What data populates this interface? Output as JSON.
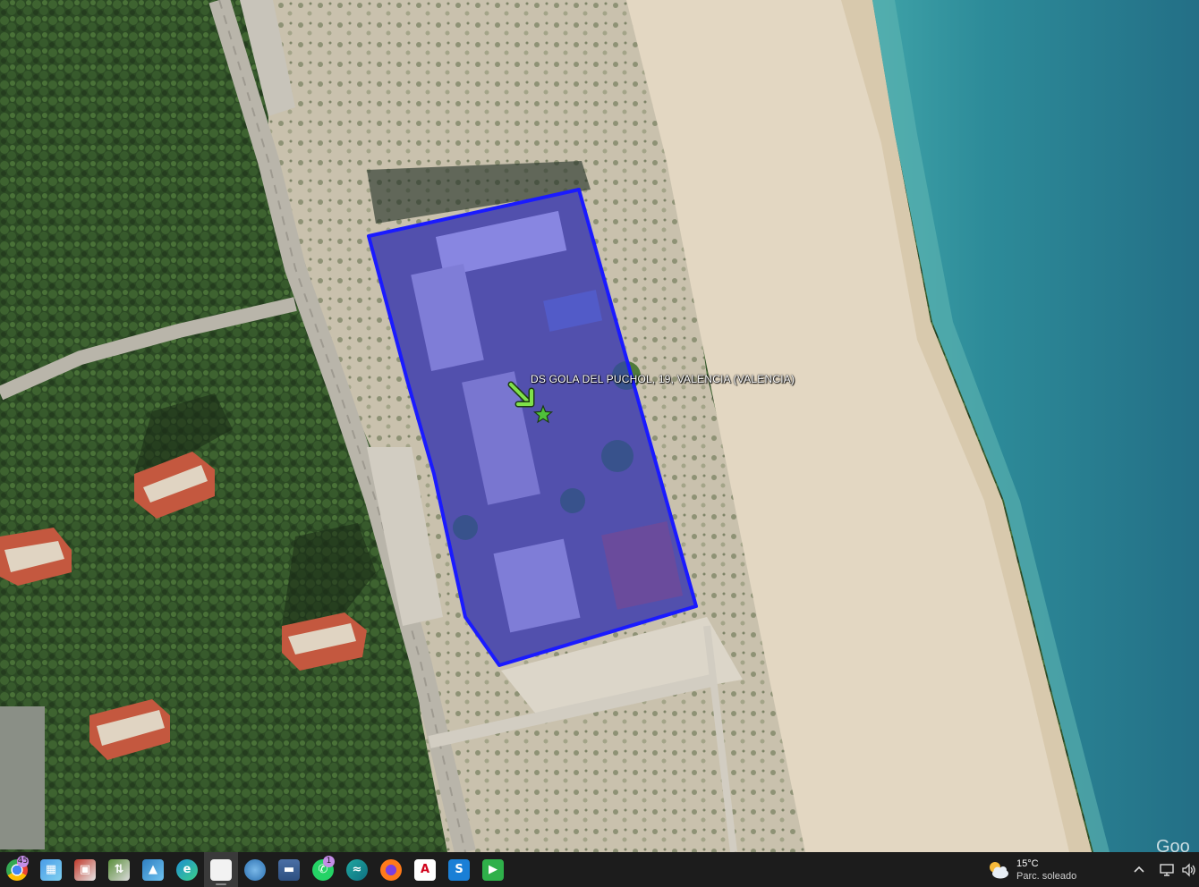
{
  "map": {
    "placemark_label": "DS GOLA DEL PUCHOL, 19, VALENCIA (VALENCIA)",
    "watermark": "Goo",
    "polygon_color": "#1a1aff",
    "marker_arrow_color": "#7fe04a",
    "marker_star_color": "#4fc03a"
  },
  "taskbar": {
    "apps": [
      {
        "name": "chrome",
        "icon": "chrome-icon",
        "badge": "45"
      },
      {
        "name": "maps-app",
        "icon": "map-app-icon"
      },
      {
        "name": "image-viewer",
        "icon": "image-viewer-icon"
      },
      {
        "name": "file-transfer",
        "icon": "file-transfer-icon"
      },
      {
        "name": "photos",
        "icon": "photos-icon"
      },
      {
        "name": "edge",
        "icon": "edge-icon"
      },
      {
        "name": "notepad",
        "icon": "document-icon",
        "active": true
      },
      {
        "name": "google-earth",
        "icon": "globe-icon"
      },
      {
        "name": "save",
        "icon": "floppy-disk-icon"
      },
      {
        "name": "whatsapp",
        "icon": "whatsapp-icon",
        "badge": "1"
      },
      {
        "name": "signal-app",
        "icon": "wave-icon"
      },
      {
        "name": "firefox",
        "icon": "firefox-icon"
      },
      {
        "name": "adobe-reader",
        "icon": "acrobat-icon"
      },
      {
        "name": "s-app",
        "icon": "s-app-icon"
      },
      {
        "name": "media-player",
        "icon": "play-icon"
      }
    ],
    "weather": {
      "temperature": "15°C",
      "condition": "Parc. soleado"
    }
  }
}
